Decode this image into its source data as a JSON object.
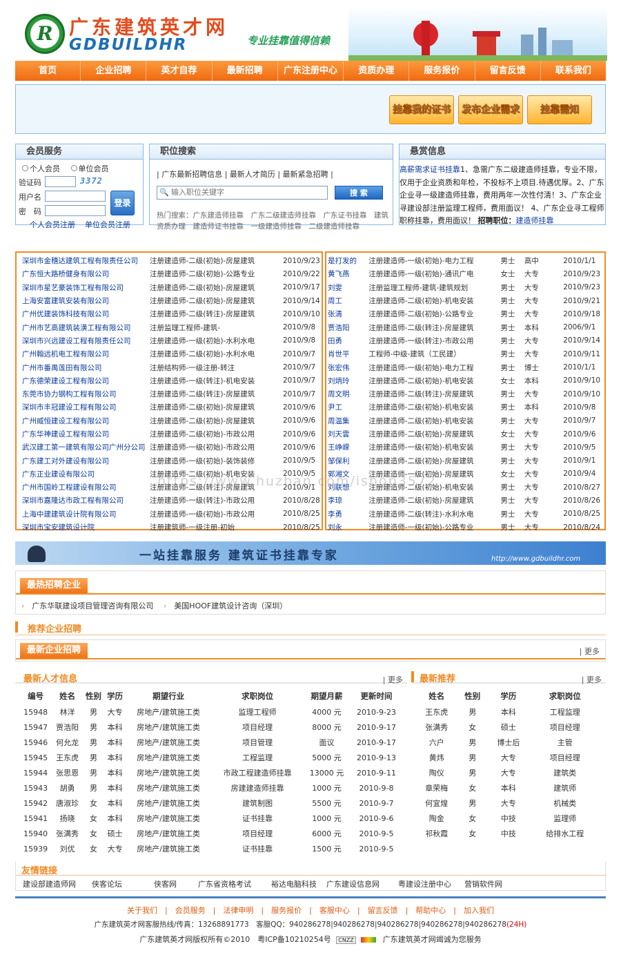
{
  "header": {
    "site_name": "广东建筑英才网",
    "site_en": "GDBUILDHR",
    "slogan": "专业挂靠值得信赖",
    "logo_letter": "R"
  },
  "nav": [
    "首页",
    "企业招聘",
    "英才自荐",
    "最新招聘",
    "广东注册中心",
    "资质办理",
    "服务报价",
    "留言反馈",
    "联系我们"
  ],
  "top_buttons": [
    "挂靠我的证书",
    "发布企业需求",
    "挂靠需知"
  ],
  "member": {
    "title": "会员服务",
    "personal": "个人会员",
    "company": "单位会员",
    "captcha_label": "验证码",
    "captcha": "3372",
    "user_label": "用户名",
    "pwd_label": "密　码",
    "login": "登录",
    "reg_personal": "个人会员注册",
    "reg_company": "单位会员注册"
  },
  "search": {
    "title": "职位搜索",
    "links": "| 广东最新招聘信息 | 最新人才简历 | 最新紧急招聘 |",
    "placeholder": "输入职位关键字",
    "button": "搜 索",
    "hot": "热门搜索：广东建造师挂靠　广东二级建造师挂靠　广东证书挂靠　建筑资质办理　建造师证书挂靠　一级建造师挂靠　二级建造师挂靠"
  },
  "bounty": {
    "title": "悬赏信息",
    "text_link1": "高薪需求证书挂靠",
    "text1": "1、急需广东二级建造师挂靠，专业不限，仅用于企业资质和年检，不投标不上项目.待遇优厚。2、广东企业寻一级建造师挂靠，费用两年一次性付清！3、广东企业寻建设部注册监理工程师，费用面议！ 4、广东企业寻工程师职称挂靠，费用面议！",
    "bold": "招聘职位：",
    "text_link2": "建造师挂靠"
  },
  "jobs": [
    [
      "深圳市金穗达建筑工程有限责任公司",
      "注册建造师-二级(初始)-房屋建筑",
      "2010/9/23"
    ],
    [
      "广东恒大路桥健身有限公司",
      "注册建造师-二级(初始)-公路专业",
      "2010/9/22"
    ],
    [
      "深圳市星艺豪装饰工程有限公司",
      "注册建造师-二级(初始)-房屋建筑",
      "2010/9/17"
    ],
    [
      "上海安富建筑安装有限公司",
      "注册建造师-二级(初始)-房屋建筑",
      "2010/9/14"
    ],
    [
      "广州优建装饰科技有限公司",
      "注册建造师-二级(转注)-房屋建筑",
      "2010/9/10"
    ],
    [
      "广州市艺高建筑装潢工程有限公司",
      "注册监理工程师-建筑-",
      "2010/9/8"
    ],
    [
      "深圳市兴远建设工程有限责任公司",
      "注册建造师-一级(初始)-水利水电",
      "2010/9/8"
    ],
    [
      "广州翰远机电工程有限公司",
      "注册建造师-二级(初始)-水利水电",
      "2010/9/7"
    ],
    [
      "广州市番禺莲田有限公司",
      "注册结构师-一级注册-转注",
      "2010/9/7"
    ],
    [
      "广东德荣建设工程有限公司",
      "注册建造师-一级(转注)-机电安装",
      "2010/9/7"
    ],
    [
      "东莞市协力钢构工程有限公司",
      "注册建造师-二级(转注)-房屋建筑",
      "2010/9/7"
    ],
    [
      "深圳市丰冠建设工程有限公司",
      "注册建造师-二级(初始)-房屋建筑",
      "2010/9/6"
    ],
    [
      "广州威恒建设工程有限公司",
      "注册建造师-二级(初始)-房屋建筑",
      "2010/9/6"
    ],
    [
      "广东华神建设工程有限公司",
      "注册建造师-二级(初始)-市政公用",
      "2010/9/6"
    ],
    [
      "武汉建工第一建筑有限公司广州分公司",
      "注册建造师-一级(初始)-市政公用",
      "2010/9/6"
    ],
    [
      "广东建工对外建设有限公司",
      "注册建造师-一级(初始)-装饰装修",
      "2010/9/5"
    ],
    [
      "广东正业建设有限公司",
      "注册建造师-二级(初始)-机电安装",
      "2010/9/5"
    ],
    [
      "广州市国岭工程建设有限公司",
      "注册建造师-二级(转注)-房屋建筑",
      "2010/9/1"
    ],
    [
      "深圳市嘉隆达市政工程有限公司",
      "注册建造师-一级(转注)-市政公用",
      "2010/8/28"
    ],
    [
      "上海中建建筑设计院有限公司",
      "注册建造师-一级(初始)-市政公用",
      "2010/8/25"
    ],
    [
      "深圳市宝安建筑设计院",
      "注册建筑师-一级注册-初始",
      "2010/8/25"
    ]
  ],
  "talents": [
    [
      "是打发的",
      "注册建造师-一级(初始)-电力工程",
      "男士",
      "高中",
      "2010/1/1"
    ],
    [
      "黄飞燕",
      "注册建造师-一级(初始)-通讯广电",
      "女士",
      "大专",
      "2010/9/23"
    ],
    [
      "刘雯",
      "注册监理工程师-建筑-建筑规划",
      "男士",
      "大专",
      "2010/9/23"
    ],
    [
      "周工",
      "注册建造师-二级(初始)-机电安装",
      "男士",
      "大专",
      "2010/9/21"
    ],
    [
      "张清",
      "注册建造师-二级(初始)-公路专业",
      "男士",
      "大专",
      "2010/9/18"
    ],
    [
      "贾浩阳",
      "注册建造师-二级(转注)-房屋建筑",
      "男士",
      "本科",
      "2006/9/1"
    ],
    [
      "田勇",
      "注册建造师-一级(转注)-市政公用",
      "男士",
      "大专",
      "2010/9/14"
    ],
    [
      "肖世平",
      "工程师-中级-建筑（工民建）",
      "男士",
      "大专",
      "2010/9/11"
    ],
    [
      "张宏伟",
      "注册建造师-一级(初始)-电力工程",
      "男士",
      "博士",
      "2010/1/1"
    ],
    [
      "刘炳玲",
      "注册建造师-二级(初始)-机电安装",
      "女士",
      "本科",
      "2010/9/10"
    ],
    [
      "周文明",
      "注册建造师-二级(转注)-房屋建筑",
      "男士",
      "大专",
      "2010/9/10"
    ],
    [
      "尹工",
      "注册建造师-二级(初始)-机电安装",
      "男士",
      "本科",
      "2010/9/8"
    ],
    [
      "周温集",
      "注册建造师-二级(初始)-机电安装",
      "男士",
      "大专",
      "2010/9/7"
    ],
    [
      "刘天雲",
      "注册建造师-二级(初始)-房屋建筑",
      "女士",
      "大专",
      "2010/9/6"
    ],
    [
      "王峥嵘",
      "注册建造师-一级(初始)-机电安装",
      "男士",
      "大专",
      "2010/9/5"
    ],
    [
      "邹保利",
      "注册建造师-二级(初始)-房屋建筑",
      "男士",
      "大专",
      "2010/9/1"
    ],
    [
      "郭湘文",
      "注册建造师-一级(初始)-房屋建筑",
      "女士",
      "大专",
      "2010/9/4"
    ],
    [
      "刘联想",
      "注册建造师-二级(初始)-机电安装",
      "男士",
      "大专",
      "2010/8/27"
    ],
    [
      "李琼",
      "注册建造师-二级(初始)-房屋建筑",
      "男士",
      "大专",
      "2010/8/26"
    ],
    [
      "李勇",
      "注册建造师-二级(转注)-水利水电",
      "男士",
      "大专",
      "2010/8/25"
    ],
    [
      "刘永",
      "注册建造师-一级(初始)-公路专业",
      "男士",
      "大专",
      "2010/8/24"
    ]
  ],
  "watermark": "https://www.huzhan.com/ishop3572",
  "banner2": {
    "text": "一站挂靠服务 建筑证书挂靠专家",
    "url": "http://www.gdbuildhr.com"
  },
  "hot_companies": {
    "title": "最热招聘企业",
    "items": [
      "广东华联建设项目管理咨询有限公司",
      "美国HOOF建筑设计咨询（深圳）"
    ]
  },
  "recommend": {
    "title": "推荐企业招聘"
  },
  "latest_company": {
    "title": "最新企业招聘",
    "more": "更多"
  },
  "latest_talent": {
    "title": "最新人才信息",
    "more": "更多",
    "headers": [
      "编号",
      "姓名",
      "性别",
      "学历",
      "期望行业",
      "求职岗位",
      "期望月薪",
      "更新时间"
    ],
    "rows": [
      [
        "15948",
        "林洋",
        "男",
        "大专",
        "房地产/建筑施工类",
        "监理工程师",
        "4000 元",
        "2010-9-23"
      ],
      [
        "15947",
        "贾浩阳",
        "男",
        "本科",
        "房地产/建筑施工类",
        "项目经理",
        "8000 元",
        "2010-9-17"
      ],
      [
        "15946",
        "何允龙",
        "男",
        "本科",
        "房地产/建筑施工类",
        "项目管理",
        "面议",
        "2010-9-17"
      ],
      [
        "15945",
        "王东虎",
        "男",
        "本科",
        "房地产/建筑施工类",
        "工程监理",
        "5000 元",
        "2010-9-13"
      ],
      [
        "15944",
        "张思恩",
        "男",
        "本科",
        "房地产/建筑施工类",
        "市政工程建造师挂靠",
        "13000 元",
        "2010-9-11"
      ],
      [
        "15943",
        "胡勇",
        "男",
        "本科",
        "房地产/建筑施工类",
        "房建建造师挂靠",
        "1000 元",
        "2010-9-8"
      ],
      [
        "15942",
        "唐淑珍",
        "女",
        "本科",
        "房地产/建筑施工类",
        "建筑制图",
        "5500 元",
        "2010-9-7"
      ],
      [
        "15941",
        "扬晓",
        "女",
        "本科",
        "房地产/建筑施工类",
        "证书挂靠",
        "1000 元",
        "2010-9-6"
      ],
      [
        "15940",
        "张满秀",
        "女",
        "硕士",
        "房地产/建筑施工类",
        "项目经理",
        "6000 元",
        "2010-9-5"
      ],
      [
        "15939",
        "刘优",
        "女",
        "大专",
        "房地产/建筑施工类",
        "证书挂靠",
        "1500 元",
        "2010-9-5"
      ]
    ]
  },
  "latest_recommend": {
    "title": "最新推荐",
    "more": "更多",
    "headers": [
      "姓名",
      "性别",
      "学历",
      "求职岗位"
    ],
    "rows": [
      [
        "王东虎",
        "男",
        "本科",
        "工程监理"
      ],
      [
        "张满秀",
        "女",
        "硕士",
        "项目经理"
      ],
      [
        "六户",
        "男",
        "博士后",
        "主管"
      ],
      [
        "黄炜",
        "男",
        "大专",
        "项目经理"
      ],
      [
        "陶仪",
        "男",
        "大专",
        "建筑类"
      ],
      [
        "章荣梅",
        "女",
        "本科",
        "建筑师"
      ],
      [
        "何宜煌",
        "男",
        "大专",
        "机械类"
      ],
      [
        "陶金",
        "女",
        "中技",
        "监理师"
      ],
      [
        "祁秋霞",
        "女",
        "中技",
        "给排水工程"
      ]
    ]
  },
  "friend_links": {
    "title": "友情链接",
    "items": [
      "建设部建造师网",
      "侠客论坛",
      "侠客网",
      "广东省资格考试",
      "裕达电脑科技",
      "广东建设信息网",
      "粤建设注册中心",
      "营销软件网"
    ]
  },
  "footer": {
    "links": [
      "关于我们",
      "会员服务",
      "法律申明",
      "服务报价",
      "客服中心",
      "留言反馈",
      "帮助中心",
      "加入我们"
    ],
    "contact_prefix": "广东建筑英才网客服热线/传真：13268891773　客服QQ：940286278|940286278|940286278|940286278|940286278",
    "contact_suffix": "(24H)",
    "copyright": "广东建筑英才网版权所有©2010　粤ICP备10210254号",
    "badge": "CNZZ",
    "sincere": "广东建筑英才网竭诚为您服务"
  },
  "colors": {
    "orange": "#f08a24",
    "blue_border": "#8bb7e0",
    "link": "#0a3a9c"
  }
}
